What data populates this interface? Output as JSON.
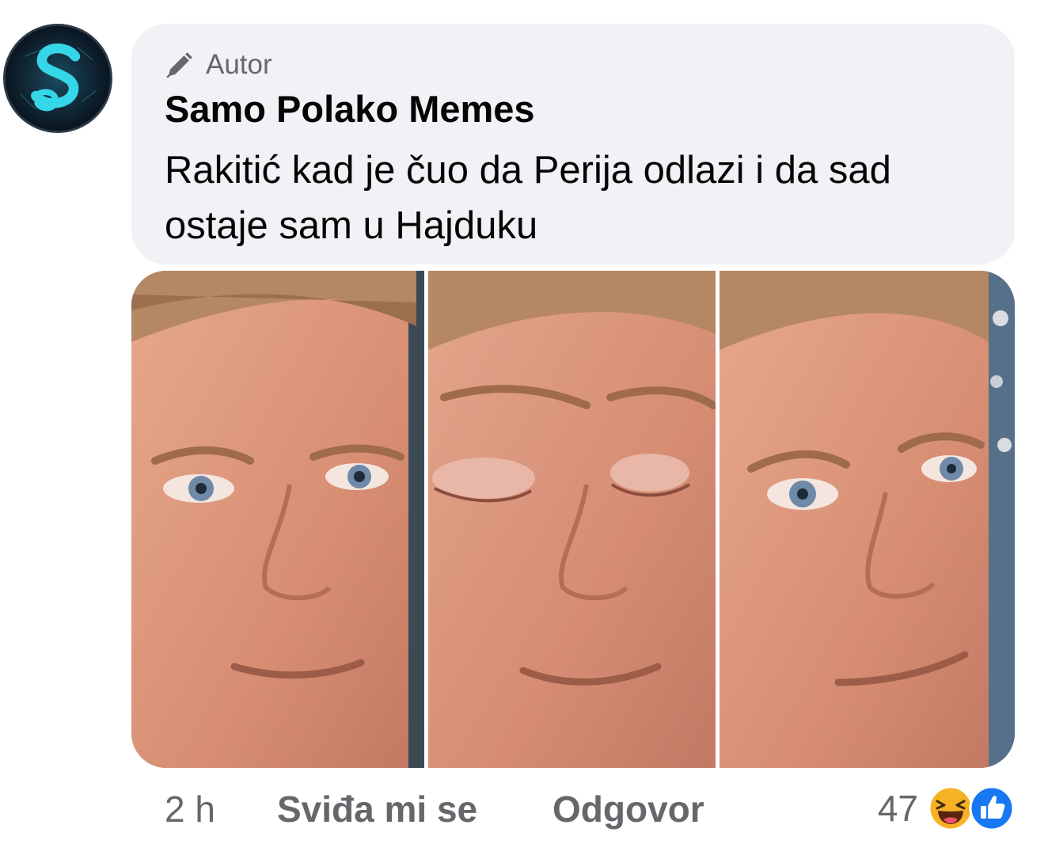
{
  "comment": {
    "badge_label": "Autor",
    "author_name": "Samo Polako Memes",
    "text": "Rakitić kad je čuo da Perija odlazi i da sad ostaje sam u Hajduku",
    "avatar_letter": "S",
    "avatar_icon": "logo-s-icon",
    "badge_icon": "pencil-icon",
    "colors": {
      "bubble": "#f0f2f5",
      "text": "#050505",
      "secondary": "#65676b",
      "avatar_glow": "#35d6e8",
      "like_blue": "#1877f2",
      "haha_yellow": "#f7b125"
    }
  },
  "image": {
    "panels": [
      {
        "eyes": "open"
      },
      {
        "eyes": "closed"
      },
      {
        "eyes": "open"
      }
    ]
  },
  "actions": {
    "time": "2 h",
    "like_label": "Sviđa mi se",
    "reply_label": "Odgovor"
  },
  "reactions": {
    "count": "47",
    "icons": [
      "haha-icon",
      "like-icon"
    ]
  }
}
